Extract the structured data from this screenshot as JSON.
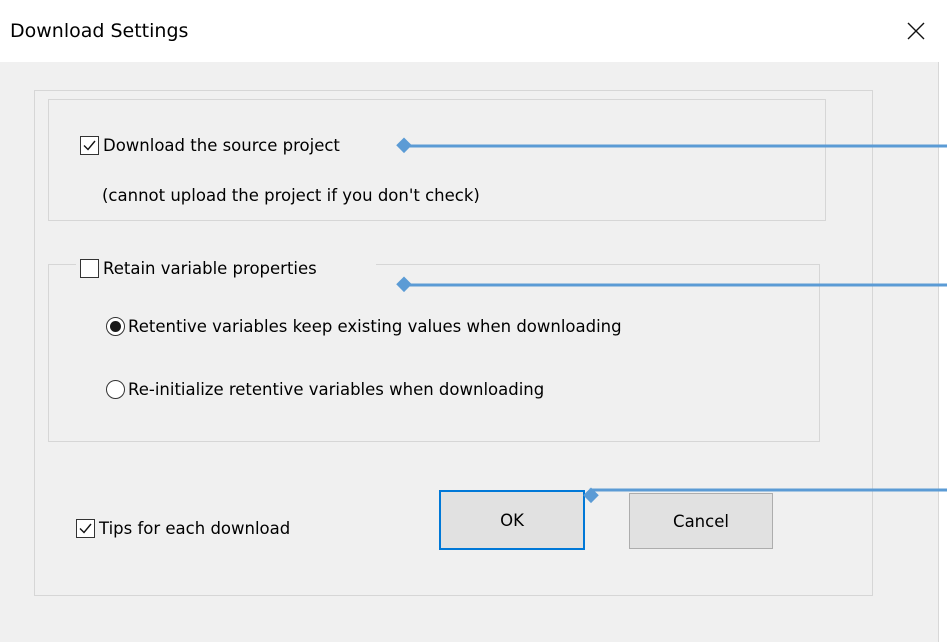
{
  "window": {
    "title": "Download Settings",
    "close_icon": "close-icon"
  },
  "options": {
    "download_source": {
      "label": "Download the source project",
      "checked": true
    },
    "download_source_note": "(cannot upload the project if you don't check)",
    "retain_variable_properties": {
      "label": "Retain variable properties",
      "checked": false
    },
    "radio_keep_values": {
      "label": "Retentive variables keep existing values when downloading",
      "selected": true
    },
    "radio_reinitialize": {
      "label": "Re-initialize retentive variables when downloading",
      "selected": false
    },
    "tips_each_download": {
      "label": "Tips for each download",
      "checked": true
    }
  },
  "buttons": {
    "ok_label": "OK",
    "cancel_label": "Cancel"
  },
  "colors": {
    "accent": "#0078d7",
    "callout": "#5b9bd5",
    "dialog_bg": "#f0f0f0"
  }
}
